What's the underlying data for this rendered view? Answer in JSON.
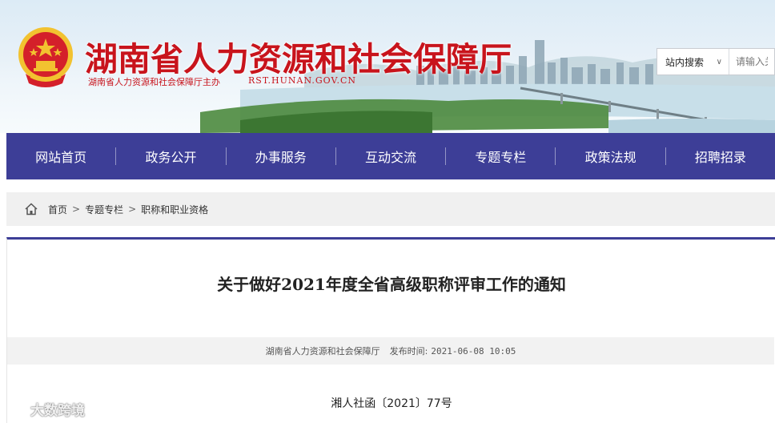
{
  "header": {
    "title": "湖南省人力资源和社会保障厅",
    "subtitle": "湖南省人力资源和社会保障厅主办",
    "url": "RST.HUNAN.GOV.CN"
  },
  "search": {
    "scope": "站内搜索",
    "placeholder": "请输入关键字"
  },
  "nav": {
    "items": [
      "网站首页",
      "政务公开",
      "办事服务",
      "互动交流",
      "专题专栏",
      "政策法规",
      "招聘招录"
    ]
  },
  "breadcrumb": {
    "items": [
      "首页",
      "专题专栏",
      "职称和职业资格"
    ],
    "separator": ">"
  },
  "article": {
    "title": "关于做好2021年度全省高级职称评审工作的通知",
    "source": "湖南省人力资源和社会保障厅",
    "publish_label": "发布时间:",
    "publish_time": "2021-06-08 10:05",
    "doc_number": "湘人社函〔2021〕77号"
  },
  "watermark": {
    "text": "大数跨境"
  },
  "colors": {
    "brand_red": "#c8141c",
    "nav_bg": "#3d3e97",
    "crumb_bg": "#f0f0f0"
  },
  "icons": {
    "emblem": "national-emblem",
    "home": "home-icon",
    "dropdown": "chevron-down-icon"
  }
}
